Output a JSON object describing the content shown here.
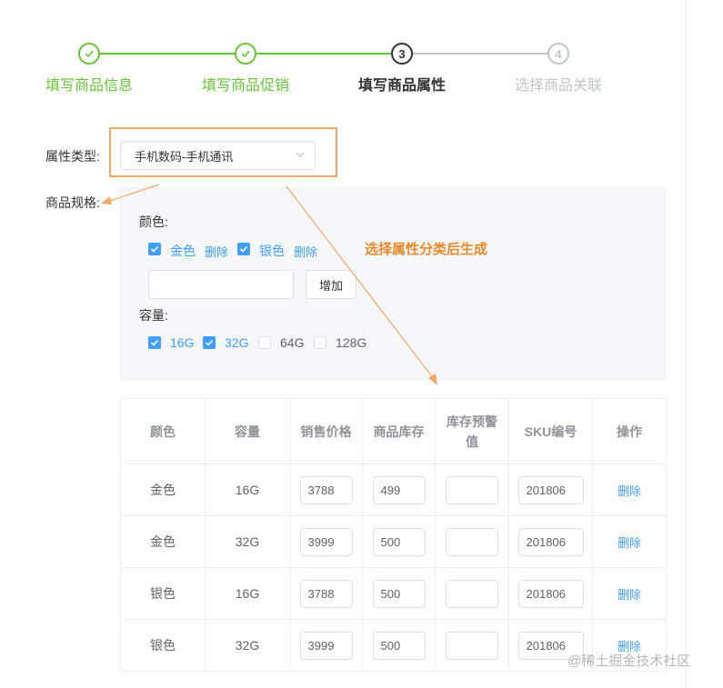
{
  "steps": [
    {
      "label": "填写商品信息",
      "state": "done"
    },
    {
      "label": "填写商品促销",
      "state": "done"
    },
    {
      "label": "填写商品属性",
      "state": "active",
      "num": "3"
    },
    {
      "label": "选择商品关联",
      "state": "pending",
      "num": "4"
    }
  ],
  "form": {
    "attr_type_label": "属性类型:",
    "attr_type_value": "手机数码-手机通讯",
    "spec_label": "商品规格:"
  },
  "spec": {
    "color": {
      "label": "颜色:",
      "options": [
        {
          "text": "金色",
          "checked": true,
          "delete": "删除"
        },
        {
          "text": "银色",
          "checked": true,
          "delete": "删除"
        }
      ],
      "add_button": "增加"
    },
    "capacity": {
      "label": "容量:",
      "options": [
        {
          "text": "16G",
          "checked": true
        },
        {
          "text": "32G",
          "checked": true
        },
        {
          "text": "64G",
          "checked": false
        },
        {
          "text": "128G",
          "checked": false
        }
      ]
    }
  },
  "annotation": "选择属性分类后生成",
  "table": {
    "headers": [
      "颜色",
      "容量",
      "销售价格",
      "商品库存",
      "库存预警值",
      "SKU编号",
      "操作"
    ],
    "rows": [
      {
        "color": "金色",
        "capacity": "16G",
        "price": "3788",
        "stock": "499",
        "warn": "",
        "sku": "201806",
        "action": "删除"
      },
      {
        "color": "金色",
        "capacity": "32G",
        "price": "3999",
        "stock": "500",
        "warn": "",
        "sku": "201806",
        "action": "删除"
      },
      {
        "color": "银色",
        "capacity": "16G",
        "price": "3788",
        "stock": "500",
        "warn": "",
        "sku": "201806",
        "action": "删除"
      },
      {
        "color": "银色",
        "capacity": "32G",
        "price": "3999",
        "stock": "500",
        "warn": "",
        "sku": "201806",
        "action": "删除"
      }
    ]
  },
  "watermark": "@稀土掘金技术社区",
  "colors": {
    "success": "#67c23a",
    "active": "#303133",
    "pending": "#c0c4cc",
    "primary": "#409eff",
    "annotation": "#e8892d"
  }
}
